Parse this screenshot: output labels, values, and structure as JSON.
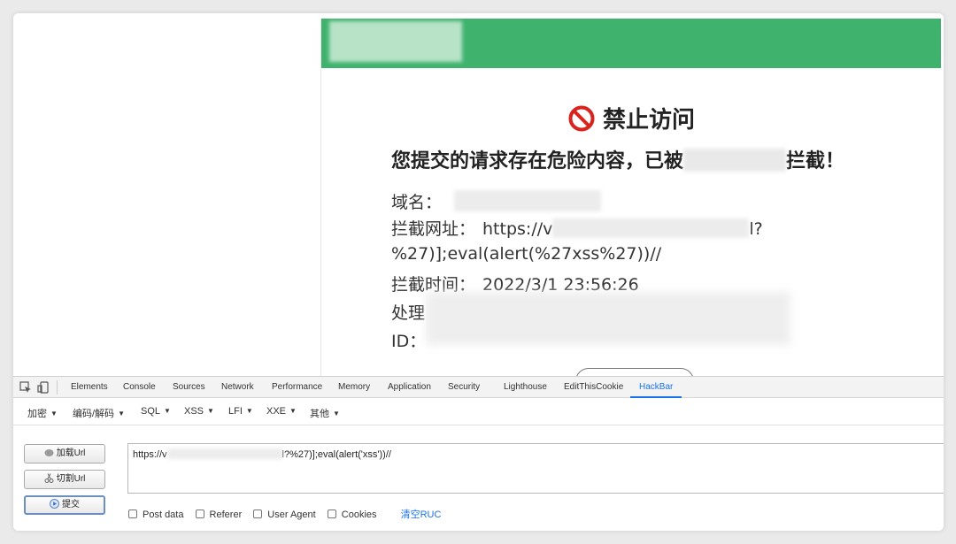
{
  "page": {
    "block_title": "禁止访问",
    "heading_prefix": "您提交的请求存在危险内容，已被",
    "heading_suffix": "拦截！",
    "domain_label": "域名：",
    "url_label": "拦截网址：",
    "url_value_start": "https://v",
    "url_value_end": "l?%27)];eval(alert(%27xss%27))//",
    "time_label": "拦截时间：",
    "time_value": "2022/3/1 23:56:26",
    "handler_label": "处理",
    "id_label": "ID："
  },
  "devtools": {
    "tabs": [
      "Elements",
      "Console",
      "Sources",
      "Network",
      "Performance",
      "Memory",
      "Application",
      "Security",
      "Lighthouse",
      "EditThisCookie",
      "HackBar"
    ],
    "active_tab": "HackBar"
  },
  "hackbar": {
    "menus": [
      "加密",
      "编码/解码",
      "SQL",
      "XSS",
      "LFI",
      "XXE",
      "其他"
    ],
    "load_url": "加载Url",
    "split_url": "切割Url",
    "submit": "提交",
    "url_start": "https://v",
    "url_end": "l?%27)];eval(alert('xss'))//",
    "options": [
      "Post data",
      "Referer",
      "User Agent",
      "Cookies"
    ],
    "clear": "清空RUC"
  },
  "colors": {
    "header_green": "#3fb36e",
    "stop_red": "#d9231d",
    "link_blue": "#1a73e8"
  }
}
